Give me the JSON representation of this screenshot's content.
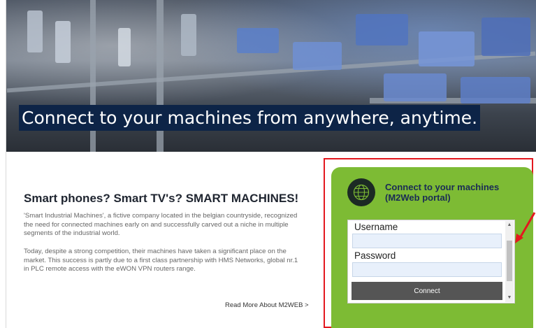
{
  "hero": {
    "title": "Connect to your machines from anywhere, anytime."
  },
  "article": {
    "heading": "Smart phones? Smart TV's? SMART MACHINES!",
    "paragraph1": "'Smart Industrial Machines', a fictive company located in the belgian countryside, recognized the need for connected machines early on and successfully carved out a niche in multiple segments of the industrial world.",
    "paragraph2": "Today, despite a strong competition, their machines have taken a significant place on the market. This success is partly due to a first class partnership with HMS Networks, global nr.1 in PLC remote access with the eWON VPN routers range.",
    "read_more": "Read More About M2WEB >"
  },
  "login": {
    "title": "Connect to your machines (M2Web portal)",
    "username_label": "Username",
    "username_value": "",
    "password_label": "Password",
    "password_value": "",
    "connect_label": "Connect"
  },
  "icons": {
    "globe": "globe-icon",
    "annotation_arrow": "arrow-icon",
    "scroll_up": "chevron-up-icon",
    "scroll_down": "chevron-down-icon"
  },
  "colors": {
    "panel_green": "#7dbb34",
    "highlight_red": "#e3181f",
    "title_navy": "#0d2447",
    "login_title": "#1a2b55"
  }
}
